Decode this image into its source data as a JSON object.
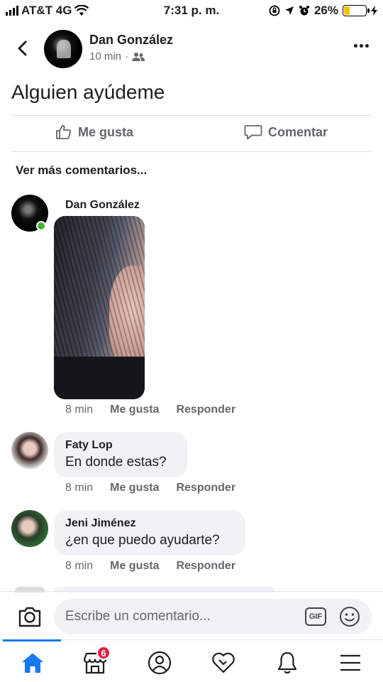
{
  "status_bar": {
    "carrier": "AT&T 4G",
    "time": "7:31 p. m.",
    "battery_percent": "26%",
    "battery_level": 0.26,
    "battery_color": "#f5c400"
  },
  "post": {
    "author": "Dan González",
    "time": "10 min",
    "audience_separator": "·",
    "audience_icon": "friends-icon",
    "text": "Alguien ayúdeme",
    "like_label": "Me gusta",
    "comment_label": "Comentar"
  },
  "comments_section": {
    "view_more": "Ver más comentarios..."
  },
  "comments": [
    {
      "name": "Dan González",
      "text": "",
      "has_photo": true,
      "online": true,
      "time": "8 min",
      "like": "Me gusta",
      "reply": "Responder"
    },
    {
      "name": "Faty Lop",
      "text": "En donde estas?",
      "time": "8 min",
      "like": "Me gusta",
      "reply": "Responder"
    },
    {
      "name": "Jeni Jiménez",
      "text": "¿en que puedo ayudarte?",
      "time": "8 min",
      "like": "Me gusta",
      "reply": "Responder"
    }
  ],
  "composer": {
    "placeholder": "Escribe un comentario...",
    "gif_label": "GIF"
  },
  "nav": {
    "items": [
      "home-icon",
      "marketplace-icon",
      "profile-icon",
      "dating-icon",
      "notifications-icon",
      "menu-icon"
    ],
    "marketplace_badge": "6",
    "active_color": "#1877f2"
  }
}
